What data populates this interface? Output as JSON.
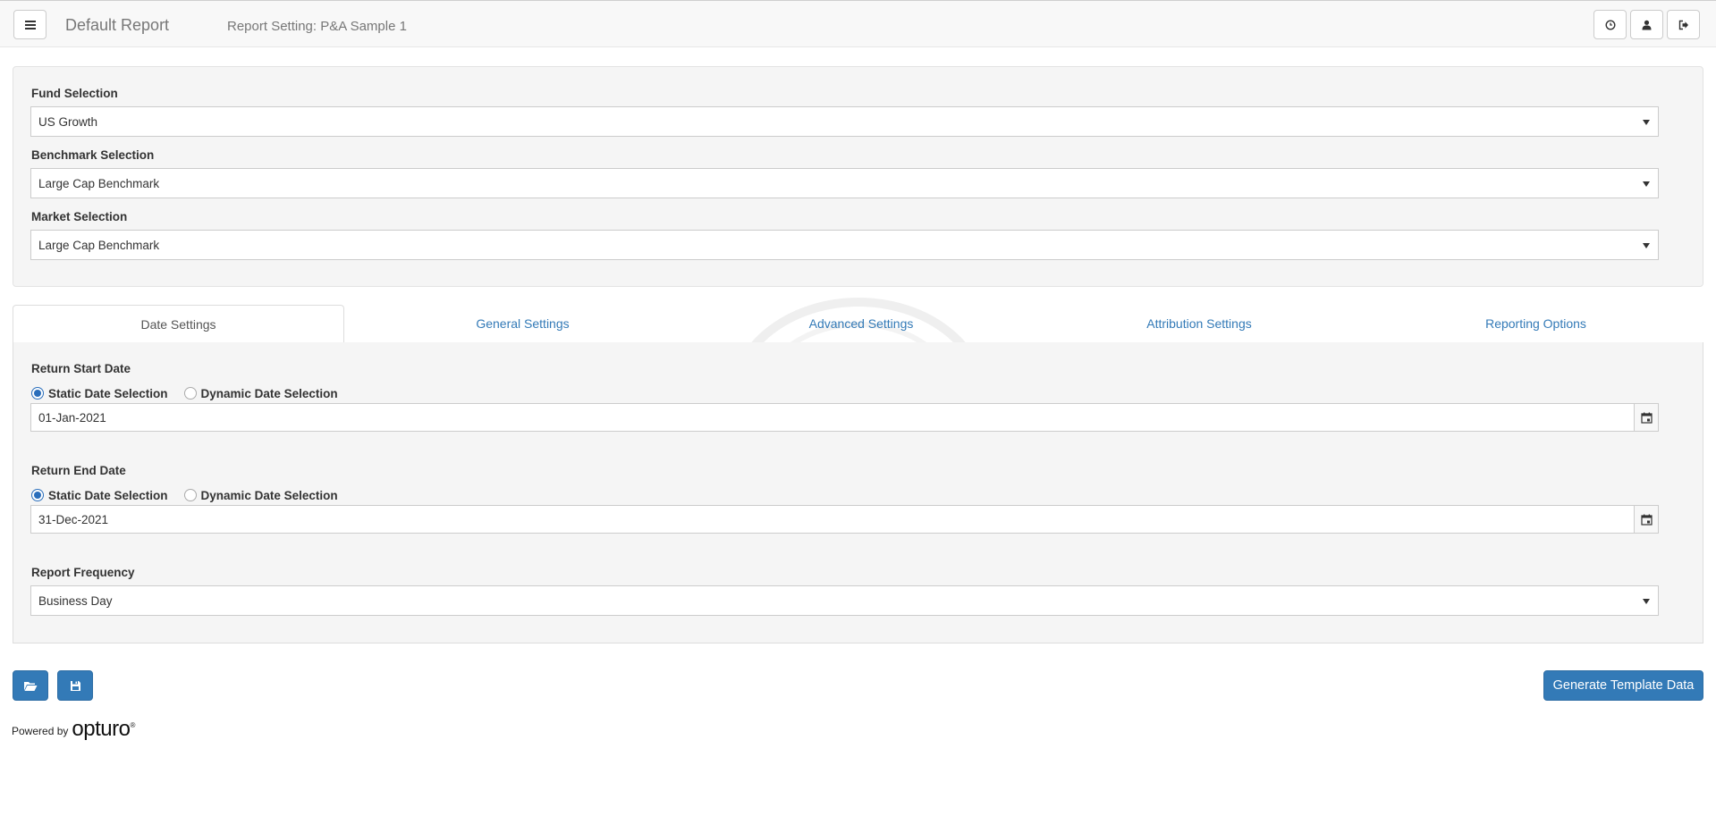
{
  "header": {
    "app_title": "Default Report",
    "report_setting": "Report Setting: P&A Sample 1",
    "menu_icon": "hamburger-menu-icon",
    "right_icons": [
      "help-clock-icon",
      "user-icon",
      "logout-icon"
    ]
  },
  "selections": {
    "fund": {
      "label": "Fund Selection",
      "value": "US Growth"
    },
    "benchmark": {
      "label": "Benchmark Selection",
      "value": "Large Cap Benchmark"
    },
    "market": {
      "label": "Market Selection",
      "value": "Large Cap Benchmark"
    }
  },
  "tabs": [
    {
      "label": "Date Settings",
      "active": true
    },
    {
      "label": "General Settings",
      "active": false
    },
    {
      "label": "Advanced Settings",
      "active": false
    },
    {
      "label": "Attribution Settings",
      "active": false
    },
    {
      "label": "Reporting Options",
      "active": false
    }
  ],
  "date_settings": {
    "start": {
      "label": "Return Start Date",
      "static_label": "Static Date Selection",
      "dynamic_label": "Dynamic Date Selection",
      "selected": "static",
      "value": "01-Jan-2021"
    },
    "end": {
      "label": "Return End Date",
      "static_label": "Static Date Selection",
      "dynamic_label": "Dynamic Date Selection",
      "selected": "static",
      "value": "31-Dec-2021"
    },
    "frequency": {
      "label": "Report Frequency",
      "value": "Business Day"
    }
  },
  "footer": {
    "open_icon": "folder-open-icon",
    "save_icon": "floppy-disk-icon",
    "generate_label": "Generate Template Data",
    "powered_text": "Powered by",
    "brand": "opturo"
  },
  "colors": {
    "primary": "#337ab7",
    "panel_bg": "#f5f5f5",
    "radio_checked": "#2a6ebb"
  }
}
